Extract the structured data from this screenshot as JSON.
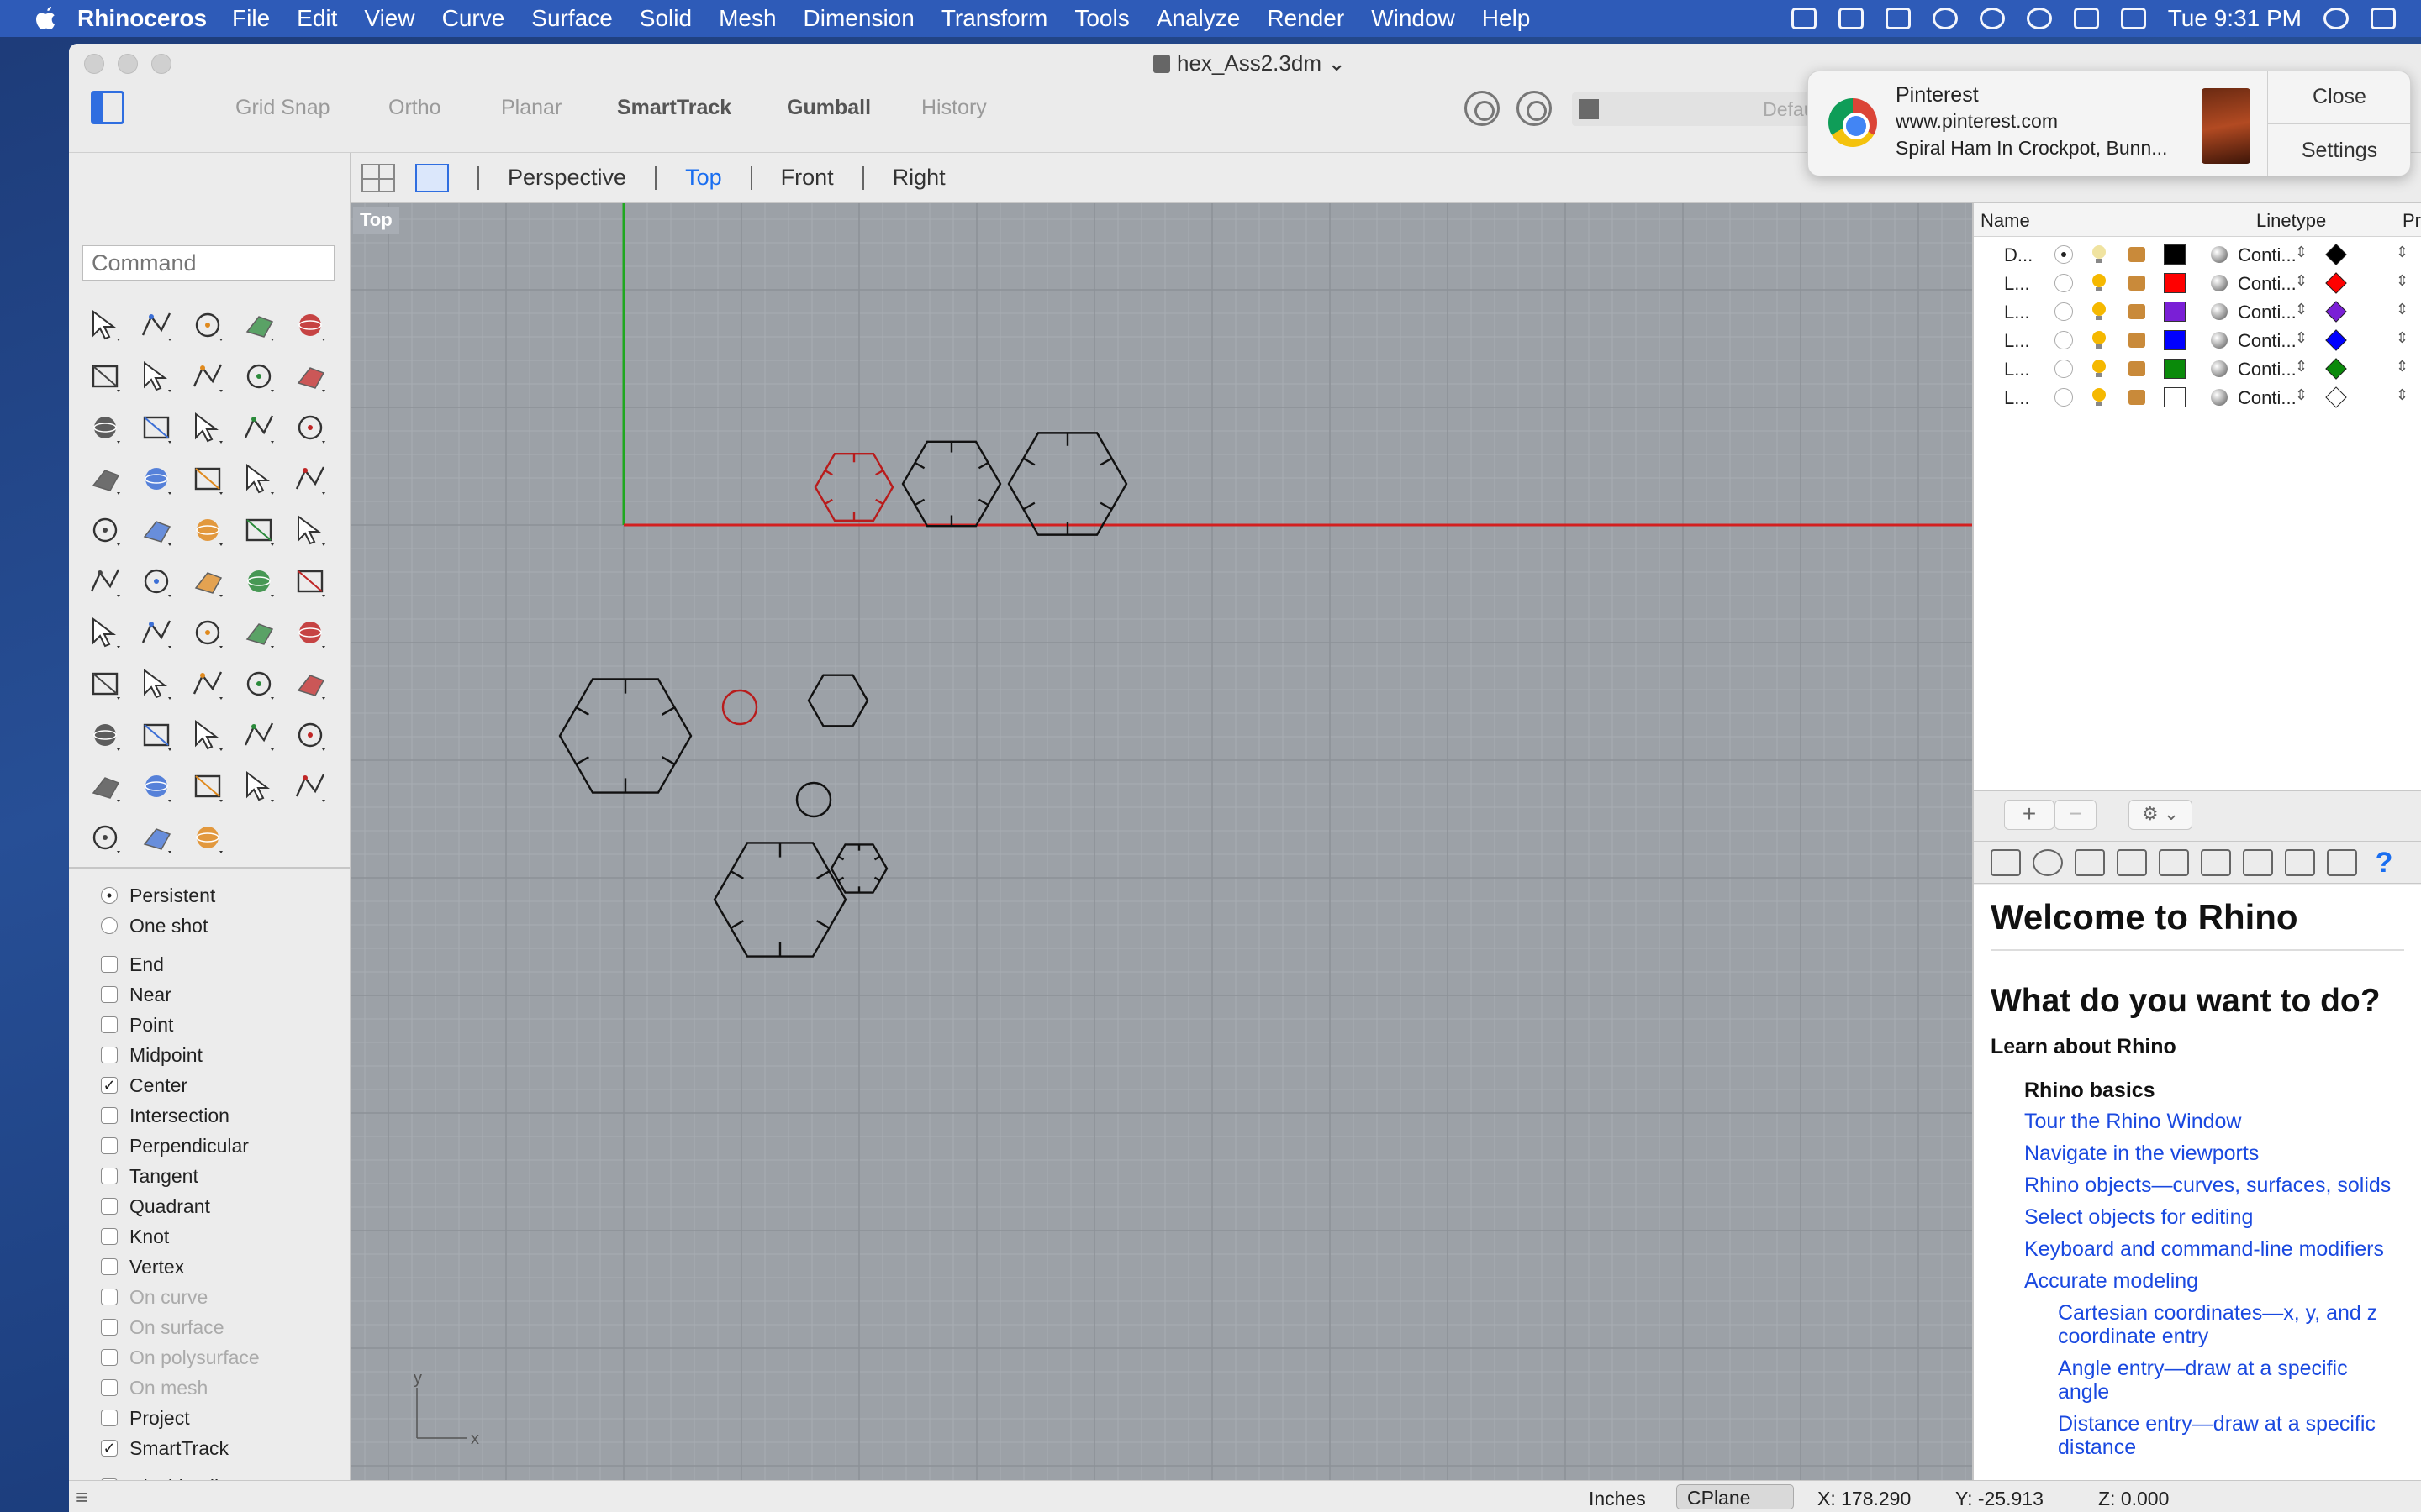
{
  "menubar": {
    "app_name": "Rhinoceros",
    "items": [
      "File",
      "Edit",
      "View",
      "Curve",
      "Surface",
      "Solid",
      "Mesh",
      "Dimension",
      "Transform",
      "Tools",
      "Analyze",
      "Render",
      "Window",
      "Help"
    ],
    "clock": "Tue 9:31 PM"
  },
  "window": {
    "doc_title": "hex_Ass2.3dm ⌄",
    "modes": [
      "Grid Snap",
      "Ortho",
      "Planar",
      "SmartTrack",
      "Gumball",
      "History"
    ],
    "layer_combo": "Default"
  },
  "viewport_tabs": [
    "Perspective",
    "Top",
    "Front",
    "Right"
  ],
  "viewport": {
    "label": "Top",
    "axis_y": "y",
    "axis_x": "x"
  },
  "command": {
    "placeholder": "Command"
  },
  "osnap": {
    "mode": [
      {
        "label": "Persistent",
        "checked": true
      },
      {
        "label": "One shot",
        "checked": false
      }
    ],
    "items": [
      {
        "label": "End",
        "checked": false,
        "enabled": true
      },
      {
        "label": "Near",
        "checked": false,
        "enabled": true
      },
      {
        "label": "Point",
        "checked": false,
        "enabled": true
      },
      {
        "label": "Midpoint",
        "checked": false,
        "enabled": true
      },
      {
        "label": "Center",
        "checked": true,
        "enabled": true
      },
      {
        "label": "Intersection",
        "checked": false,
        "enabled": true
      },
      {
        "label": "Perpendicular",
        "checked": false,
        "enabled": true
      },
      {
        "label": "Tangent",
        "checked": false,
        "enabled": true
      },
      {
        "label": "Quadrant",
        "checked": false,
        "enabled": true
      },
      {
        "label": "Knot",
        "checked": false,
        "enabled": true
      },
      {
        "label": "Vertex",
        "checked": false,
        "enabled": true
      },
      {
        "label": "On curve",
        "checked": false,
        "enabled": false
      },
      {
        "label": "On surface",
        "checked": false,
        "enabled": false
      },
      {
        "label": "On polysurface",
        "checked": false,
        "enabled": false
      },
      {
        "label": "On mesh",
        "checked": false,
        "enabled": false
      },
      {
        "label": "Project",
        "checked": false,
        "enabled": true
      },
      {
        "label": "SmartTrack",
        "checked": true,
        "enabled": true
      },
      {
        "label": "Disable all",
        "checked": false,
        "enabled": true
      }
    ]
  },
  "layers": {
    "headers": [
      "Name",
      "Linetype",
      "Pr"
    ],
    "rows": [
      {
        "name": "D...",
        "current": true,
        "color": "#000000",
        "linetype": "Conti...",
        "print_color": "#000000"
      },
      {
        "name": "L...",
        "current": false,
        "color": "#ff0000",
        "linetype": "Conti...",
        "print_color": "#ff0000"
      },
      {
        "name": "L...",
        "current": false,
        "color": "#7a1fd6",
        "linetype": "Conti...",
        "print_color": "#7a1fd6"
      },
      {
        "name": "L...",
        "current": false,
        "color": "#0000ff",
        "linetype": "Conti...",
        "print_color": "#0000ff"
      },
      {
        "name": "L...",
        "current": false,
        "color": "#0a8a0a",
        "linetype": "Conti...",
        "print_color": "#0a8a0a"
      },
      {
        "name": "L...",
        "current": false,
        "color": "#ffffff",
        "linetype": "Conti...",
        "print_color": "#ffffff"
      }
    ],
    "add_label": "+",
    "remove_label": "−",
    "gear_label": "⚙ ⌄"
  },
  "help": {
    "title": "Welcome to Rhino",
    "question": "What do you want to do?",
    "section": "Learn about Rhino",
    "subsection": "Rhino basics",
    "links": [
      "Tour the Rhino Window",
      "Navigate in the viewports",
      "Rhino objects—curves, surfaces, solids",
      "Select objects for editing",
      "Keyboard and command-line modifiers",
      "Accurate modeling"
    ],
    "sublinks": [
      "Cartesian coordinates—x, y, and z coordinate entry",
      "Angle entry—draw at a specific angle",
      "Distance entry—draw at a specific distance"
    ]
  },
  "statusbar": {
    "units": "Inches",
    "cplane": "CPlane",
    "x": "X: 178.290",
    "y": "Y: -25.913",
    "z": "Z: 0.000"
  },
  "notification": {
    "app": "Pinterest",
    "site": "www.pinterest.com",
    "message": "Spiral Ham In Crockpot, Bunn...",
    "close": "Close",
    "settings": "Settings"
  },
  "colors": {
    "menubar": "#2e5bb8",
    "accent": "#1a6ef0",
    "viewport_bg": "#9ca1a7",
    "x_axis": "#d32020",
    "y_axis": "#1fa81f",
    "selected_curve": "#b81c1c"
  }
}
